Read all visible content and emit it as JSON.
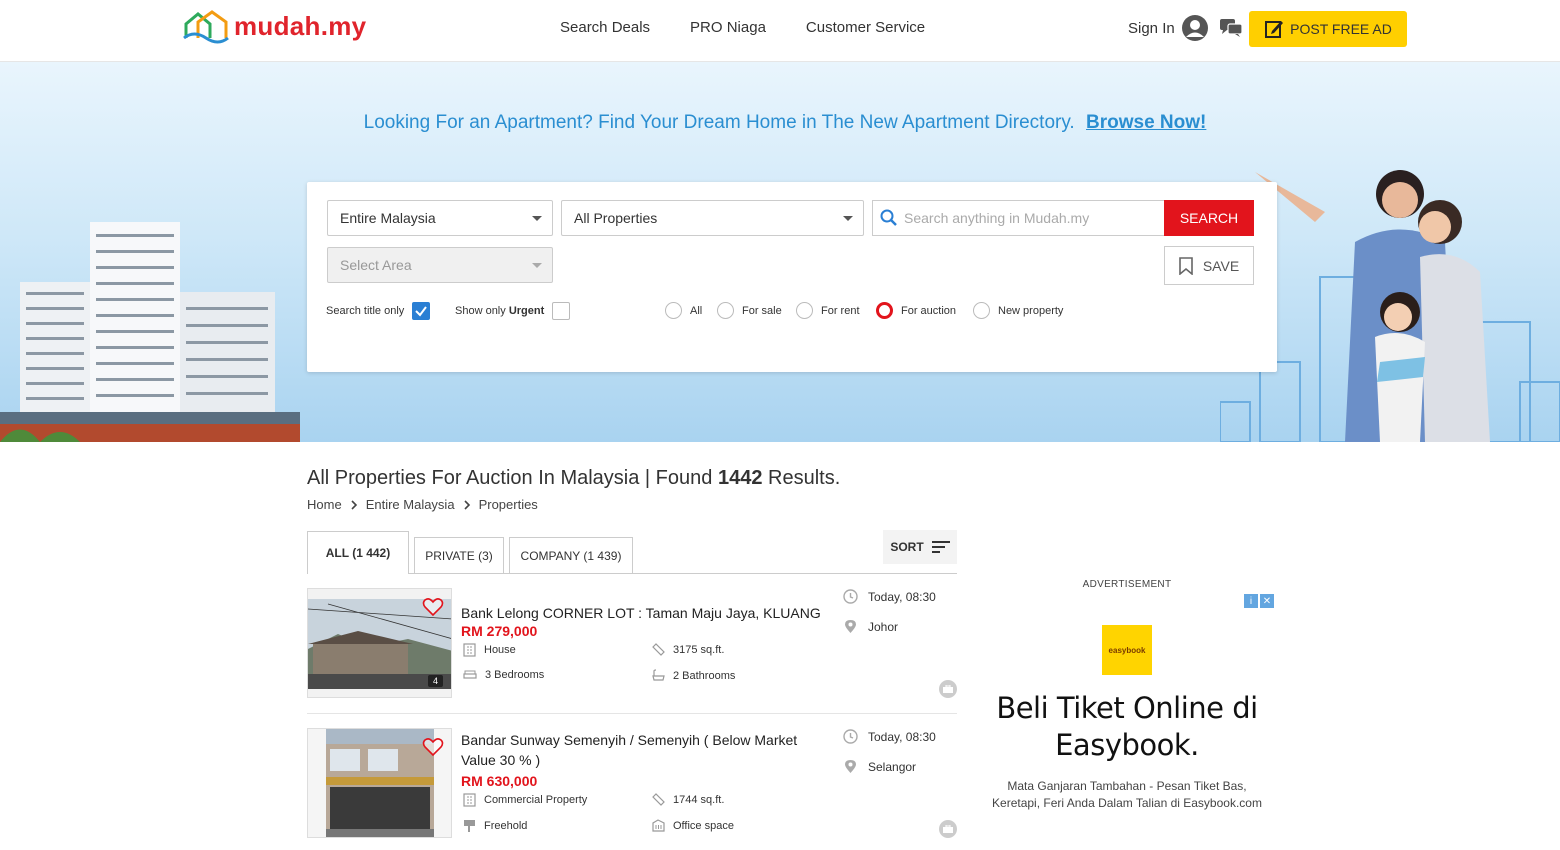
{
  "header": {
    "logo_text": "mudah.my",
    "nav": [
      "Search Deals",
      "PRO Niaga",
      "Customer Service"
    ],
    "sign_in": "Sign In",
    "post_ad": "POST FREE AD"
  },
  "promo": {
    "text": "Looking For an Apartment? Find Your Dream Home in The New Apartment Directory.",
    "link": "Browse Now!"
  },
  "search": {
    "region": "Entire Malaysia",
    "category": "All Properties",
    "area_placeholder": "Select Area",
    "query_placeholder": "Search anything in Mudah.my",
    "search_button": "SEARCH",
    "save_button": "SAVE",
    "title_only_label": "Search title only",
    "title_only_checked": true,
    "urgent_prefix": "Show only",
    "urgent_bold": "Urgent",
    "urgent_checked": false,
    "types": [
      "All",
      "For sale",
      "For rent",
      "For auction",
      "New property"
    ],
    "selected_type": "For auction"
  },
  "results": {
    "title_prefix": "All Properties For Auction In Malaysia | Found",
    "count": "1442",
    "title_suffix": "Results.",
    "breadcrumb": [
      "Home",
      "Entire Malaysia",
      "Properties"
    ],
    "tabs": [
      "ALL (1 442)",
      "PRIVATE (3)",
      "COMPANY (1 439)"
    ],
    "sort_label": "SORT"
  },
  "listings": [
    {
      "title": "Bank Lelong CORNER LOT : Taman Maju Jaya, KLUANG",
      "price": "RM 279,000",
      "photo_count": "4",
      "attrs": [
        "House",
        "3175 sq.ft.",
        "3 Bedrooms",
        "2 Bathrooms"
      ],
      "time": "Today, 08:30",
      "location": "Johor"
    },
    {
      "title": "Bandar Sunway Semenyih / Semenyih ( Below Market Value 30 % )",
      "price": "RM 630,000",
      "attrs": [
        "Commercial Property",
        "1744 sq.ft.",
        "Freehold",
        "Office space"
      ],
      "time": "Today, 08:30",
      "location": "Selangor"
    }
  ],
  "ad": {
    "label": "ADVERTISEMENT",
    "brand": "easybook",
    "headline": "Beli Tiket Online di Easybook.",
    "sub": "Mata Ganjaran Tambahan - Pesan Tiket Bas, Keretapi, Feri Anda Dalam Talian di Easybook.com"
  },
  "colors": {
    "brand_red": "#e2141c",
    "post_yellow": "#ffcf00",
    "link_blue": "#2a8ed1"
  }
}
